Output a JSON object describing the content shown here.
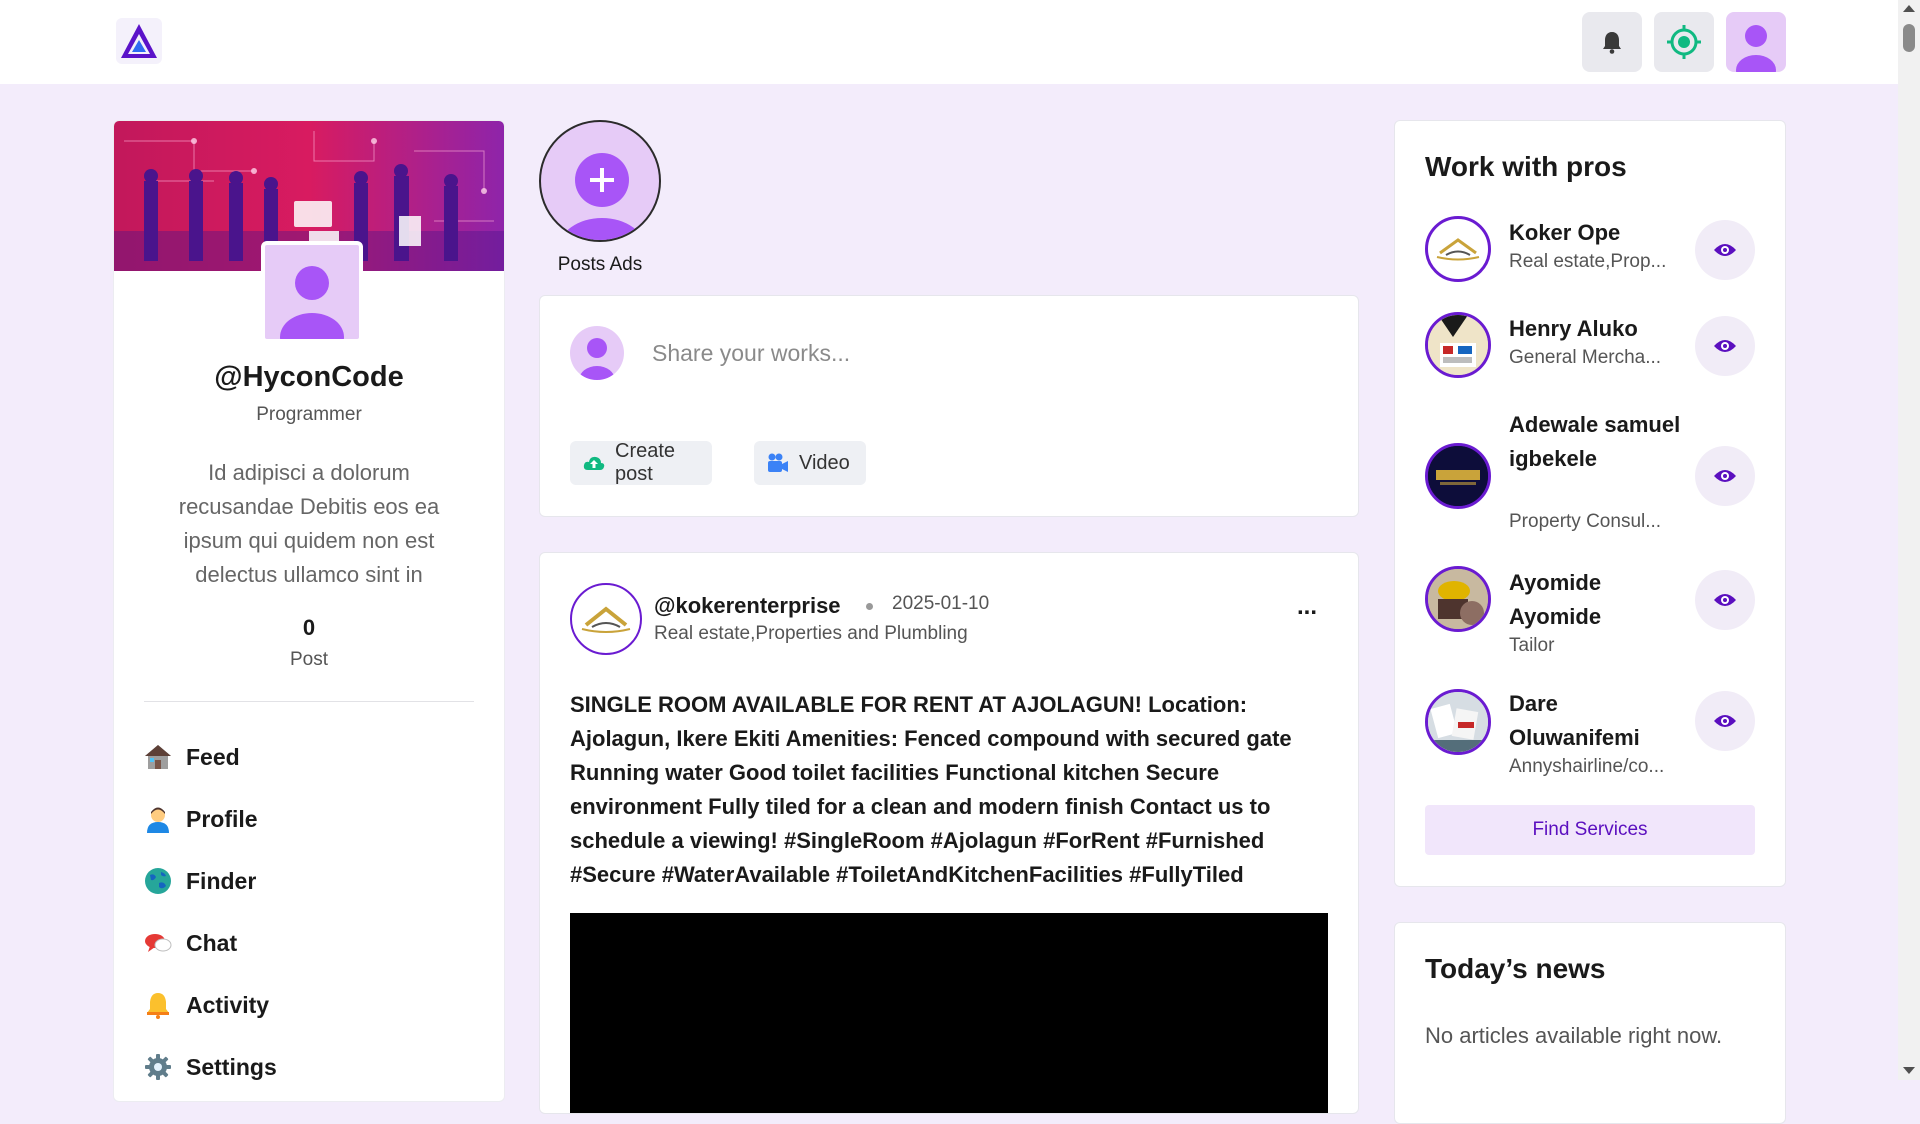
{
  "header": {
    "logo": "app-logo",
    "notifications_icon": "bell-icon",
    "target_icon": "target-icon",
    "profile_icon": "user-avatar-icon"
  },
  "profile": {
    "username": "@HyconCode",
    "role": "Programmer",
    "bio": "Id adipisci a dolorum recusandae Debitis eos ea ipsum qui quidem non est delectus ullamco sint in",
    "post_count": "0",
    "post_label": "Post"
  },
  "nav": {
    "items": [
      {
        "label": "Feed",
        "icon": "house-icon"
      },
      {
        "label": "Profile",
        "icon": "person-icon"
      },
      {
        "label": "Finder",
        "icon": "globe-icon"
      },
      {
        "label": "Chat",
        "icon": "speech-bubble-icon"
      },
      {
        "label": "Activity",
        "icon": "bell-icon"
      },
      {
        "label": "Settings",
        "icon": "gear-icon"
      }
    ]
  },
  "stories": {
    "add_label": "Posts Ads"
  },
  "composer": {
    "placeholder": "Share your works...",
    "create_post_label": "Create post",
    "video_label": "Video"
  },
  "post": {
    "handle": "@kokerenterprise",
    "date": "2025-01-10",
    "subtitle": "Real estate,Properties and Plumbling",
    "menu": "...",
    "body": "SINGLE ROOM AVAILABLE FOR RENT AT AJOLAGUN! Location: Ajolagun, Ikere Ekiti Amenities: Fenced compound with secured gate Running water Good toilet facilities Functional kitchen Secure environment Fully tiled for a clean and modern finish Contact us to schedule a viewing! #SingleRoom #Ajolagun #ForRent #Furnished #Secure #WaterAvailable #ToiletAndKitchenFacilities #FullyTiled"
  },
  "pros": {
    "title": "Work with pros",
    "items": [
      {
        "name": "Koker Ope",
        "sub": "Real estate,Prop..."
      },
      {
        "name": "Henry Aluko",
        "sub": "General Mercha..."
      },
      {
        "name": "Adewale samuel igbekele",
        "sub": "Property Consul..."
      },
      {
        "name": "Ayomide Ayomide",
        "sub": "Tailor"
      },
      {
        "name": "Dare Oluwanifemi",
        "sub": "Annyshairline/co..."
      }
    ],
    "find_services": "Find Services"
  },
  "news": {
    "title": "Today’s news",
    "empty": "No articles available right now."
  },
  "colors": {
    "accent": "#6a1bd1",
    "page_bg": "#f3ecfb",
    "avatar_bg": "#e6cbf7"
  }
}
